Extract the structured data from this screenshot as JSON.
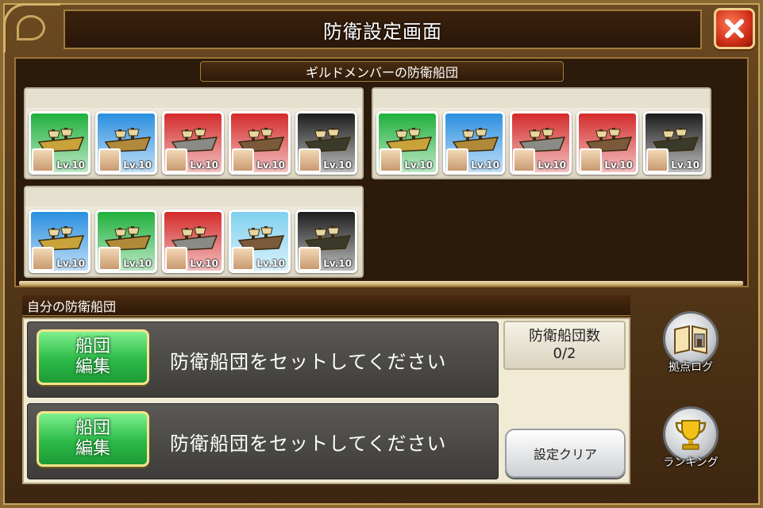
{
  "window": {
    "title": "防衛設定画面"
  },
  "guild_section": {
    "title": "ギルドメンバーの防衛船団",
    "fleets": [
      {
        "ships": [
          {
            "rarity": "green",
            "level": "Lv.10"
          },
          {
            "rarity": "blue",
            "level": "Lv.10"
          },
          {
            "rarity": "red",
            "level": "Lv.10"
          },
          {
            "rarity": "red",
            "level": "Lv.10"
          },
          {
            "rarity": "black",
            "level": "Lv.10"
          }
        ]
      },
      {
        "ships": [
          {
            "rarity": "green",
            "level": "Lv.10"
          },
          {
            "rarity": "blue",
            "level": "Lv.10"
          },
          {
            "rarity": "red",
            "level": "Lv.10"
          },
          {
            "rarity": "red",
            "level": "Lv.10"
          },
          {
            "rarity": "black",
            "level": "Lv.10"
          }
        ]
      },
      {
        "ships": [
          {
            "rarity": "blue",
            "level": "Lv.10"
          },
          {
            "rarity": "green",
            "level": "Lv.10"
          },
          {
            "rarity": "red",
            "level": "Lv.10"
          },
          {
            "rarity": "lightblue",
            "level": "Lv.10"
          },
          {
            "rarity": "black",
            "level": "Lv.10"
          }
        ]
      }
    ]
  },
  "own_section": {
    "title": "自分の防衛船団",
    "slots": [
      {
        "edit_line1": "船団",
        "edit_line2": "編集",
        "message": "防衛船団をセットしてください"
      },
      {
        "edit_line1": "船団",
        "edit_line2": "編集",
        "message": "防衛船団をセットしてください"
      }
    ],
    "count_label": "防衛船団数",
    "count_value": "0/2",
    "clear_label": "設定クリア"
  },
  "side_buttons": {
    "log_label": "拠点ログ",
    "ranking_label": "ランキング"
  },
  "colors": {
    "green": "#1fb03c",
    "blue": "#2a8fe0",
    "red": "#d42a2a",
    "lightblue": "#7fd0ee",
    "black": "#1c1c1c"
  }
}
